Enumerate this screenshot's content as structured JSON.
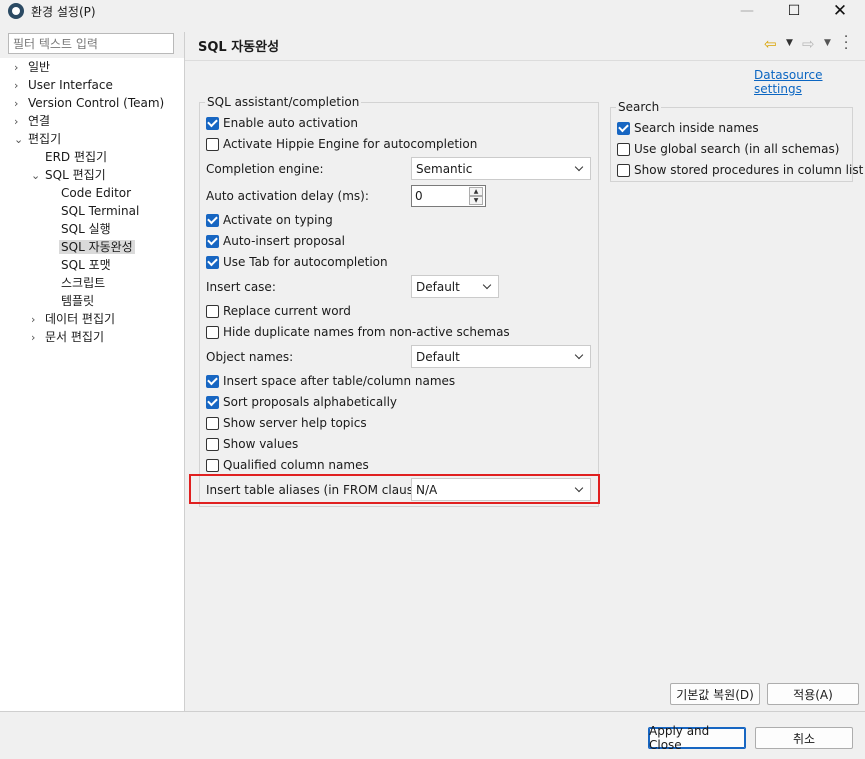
{
  "window": {
    "title": "환경 설정(P)"
  },
  "filter": {
    "placeholder": "필터 텍스트 입력"
  },
  "tree": [
    {
      "label": "일반"
    },
    {
      "label": "User Interface"
    },
    {
      "label": "Version Control (Team)"
    },
    {
      "label": "연결"
    },
    {
      "label": "편집기"
    },
    {
      "label": "ERD 편집기"
    },
    {
      "label": "SQL 편집기"
    },
    {
      "label": "Code Editor"
    },
    {
      "label": "SQL Terminal"
    },
    {
      "label": "SQL 실행"
    },
    {
      "label": "SQL 자동완성",
      "selected": true
    },
    {
      "label": "SQL 포맷"
    },
    {
      "label": "스크립트"
    },
    {
      "label": "템플릿"
    },
    {
      "label": "데이터 편집기"
    },
    {
      "label": "문서 편집기"
    }
  ],
  "header": {
    "title": "SQL 자동완성",
    "datasource_link": "Datasource settings"
  },
  "assistant": {
    "title": "SQL assistant/completion",
    "enable_auto_activation": {
      "label": "Enable auto activation",
      "checked": true
    },
    "hippie": {
      "label": "Activate Hippie Engine for autocompletion",
      "checked": false
    },
    "completion_engine": {
      "label": "Completion engine:",
      "value": "Semantic"
    },
    "delay": {
      "label": "Auto activation delay (ms):",
      "value": "0"
    },
    "activate_on_typing": {
      "label": "Activate on typing",
      "checked": true
    },
    "auto_insert": {
      "label": "Auto-insert proposal",
      "checked": true
    },
    "use_tab": {
      "label": "Use Tab for autocompletion",
      "checked": true
    },
    "insert_case": {
      "label": "Insert case:",
      "value": "Default"
    },
    "replace_word": {
      "label": "Replace current word",
      "checked": false
    },
    "hide_duplicates": {
      "label": "Hide duplicate names from non-active schemas",
      "checked": false
    },
    "object_names": {
      "label": "Object names:",
      "value": "Default"
    },
    "insert_space": {
      "label": "Insert space after table/column names",
      "checked": true
    },
    "sort_alpha": {
      "label": "Sort proposals alphabetically",
      "checked": true
    },
    "server_help": {
      "label": "Show server help topics",
      "checked": false
    },
    "show_values": {
      "label": "Show values",
      "checked": false
    },
    "qualified_columns": {
      "label": "Qualified column names",
      "checked": false
    },
    "table_aliases": {
      "label": "Insert table aliases (in FROM clause):",
      "value": "N/A"
    }
  },
  "search": {
    "title": "Search",
    "inside_names": {
      "label": "Search inside names",
      "checked": true
    },
    "global_search": {
      "label": "Use global search (in all schemas)",
      "checked": false
    },
    "stored_procs": {
      "label": "Show stored procedures in column list",
      "checked": false
    }
  },
  "buttons": {
    "restore_defaults": "기본값 복원(D)",
    "apply": "적용(A)",
    "apply_close": "Apply and Close",
    "cancel": "취소"
  },
  "colors": {
    "accent": "#1766c2",
    "highlight": "#e02020",
    "link": "#0b66c2"
  }
}
